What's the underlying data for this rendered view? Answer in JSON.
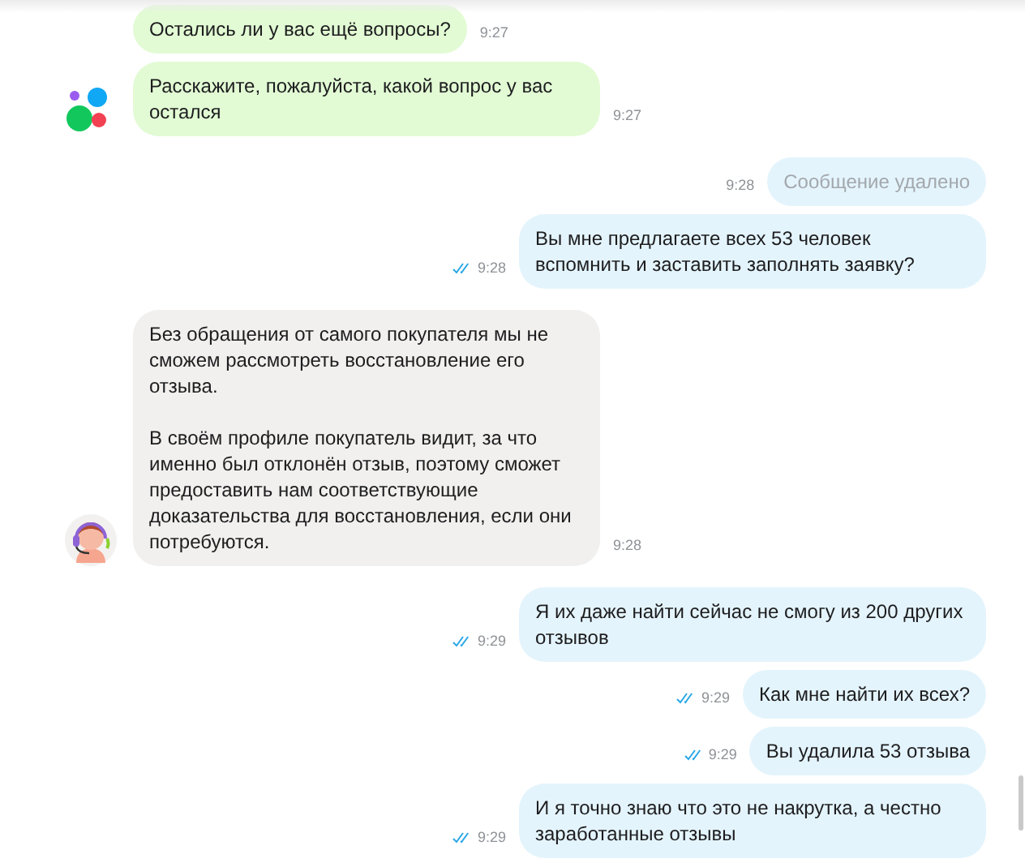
{
  "messages": [
    {
      "kind": "bot",
      "text": "Остались ли у вас ещё вопросы?",
      "time": "9:27",
      "deleted": false,
      "read": false
    },
    {
      "kind": "bot",
      "text": "Расскажите, пожалуйста, какой вопрос у вас остался",
      "time": "9:27",
      "deleted": false,
      "read": false
    },
    {
      "kind": "user",
      "text": "Сообщение удалено",
      "time": "9:28",
      "deleted": true,
      "read": false
    },
    {
      "kind": "user",
      "text": "Вы мне предлагаете всех 53 человек вспомнить и заставить заполнять заявку?",
      "time": "9:28",
      "deleted": false,
      "read": true
    },
    {
      "kind": "agent",
      "text": "Без обращения от самого покупателя мы не сможем рассмотреть восстановление его отзыва.\n\nВ своём профиле покупатель видит, за что именно был отклонён отзыв, поэтому сможет предоставить нам соответствующие доказательства для восстановления, если они потребуются.",
      "time": "9:28",
      "deleted": false,
      "read": false
    },
    {
      "kind": "user",
      "text": "Я их даже найти сейчас не смогу из 200 других отзывов",
      "time": "9:29",
      "deleted": false,
      "read": true
    },
    {
      "kind": "user",
      "text": "Как мне найти их всех?",
      "time": "9:29",
      "deleted": false,
      "read": true
    },
    {
      "kind": "user",
      "text": "Вы удалила 53 отзыва",
      "time": "9:29",
      "deleted": false,
      "read": true
    },
    {
      "kind": "user",
      "text": "И я точно знаю что это не накрутка, а честно заработанные отзывы",
      "time": "9:29",
      "deleted": false,
      "read": true
    }
  ]
}
